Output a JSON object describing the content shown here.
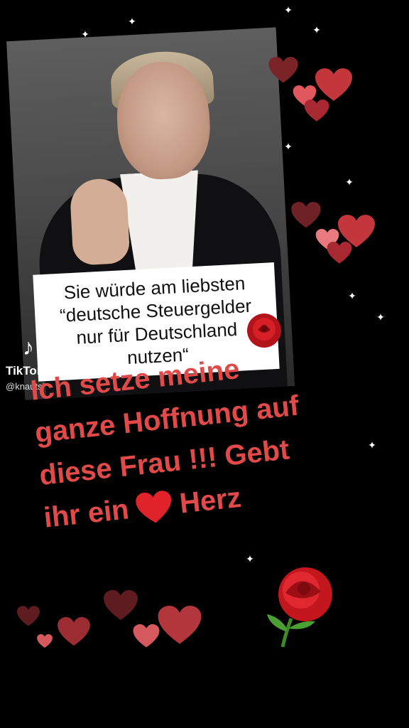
{
  "caption": {
    "lines": [
      "Sie würde am liebsten",
      "“deutsche Steuergelder",
      "nur für Deutschland",
      "nutzen“"
    ]
  },
  "watermark": {
    "brand": "TikTok",
    "username": "@knautsi"
  },
  "message": {
    "lines": [
      "Ich setze meine",
      "ganze Hoffnung auf",
      "diese Frau !!! Gebt"
    ],
    "last_line_before": "ihr ein",
    "last_line_after": "Herz",
    "color": "#e24a4a"
  },
  "icons": {
    "inline_heart": "heart-icon",
    "rose": "rose-icon",
    "sparkle": "sparkle-icon",
    "tiktok": "tiktok-logo-icon"
  }
}
